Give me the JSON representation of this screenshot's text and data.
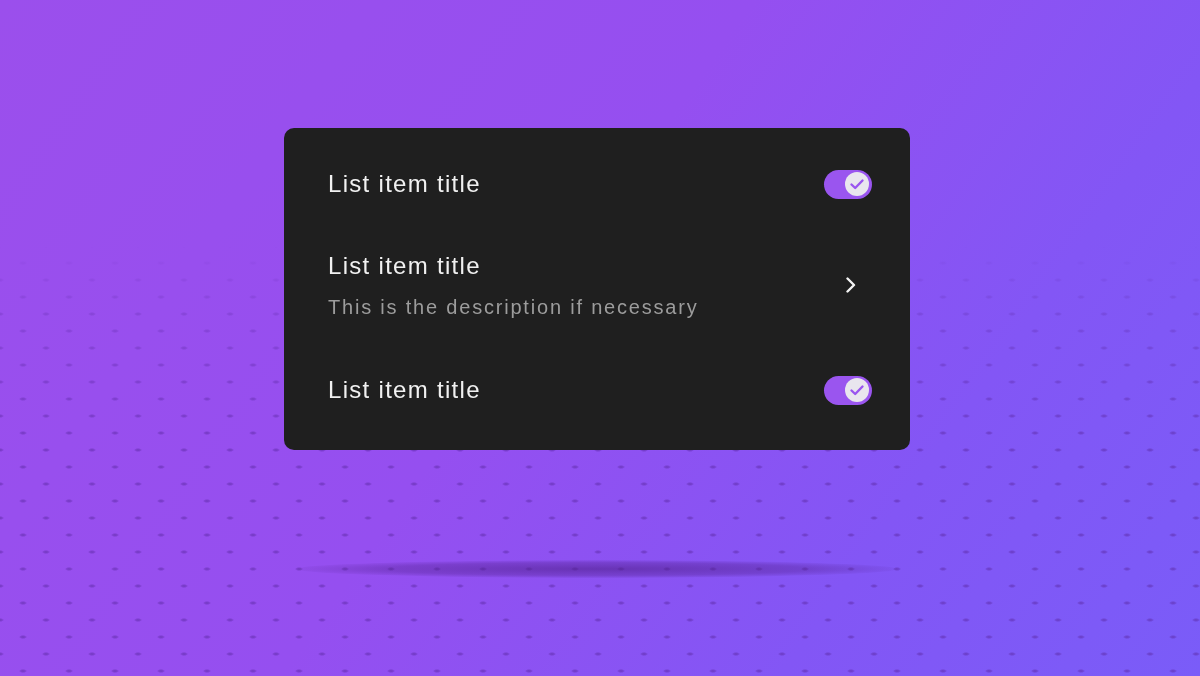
{
  "list": {
    "items": [
      {
        "kind": "toggle",
        "title": "List item title",
        "on": true
      },
      {
        "kind": "link",
        "title": "List item title",
        "description": "This is the description if necessary"
      },
      {
        "kind": "toggle",
        "title": "List item title",
        "on": true
      }
    ]
  }
}
